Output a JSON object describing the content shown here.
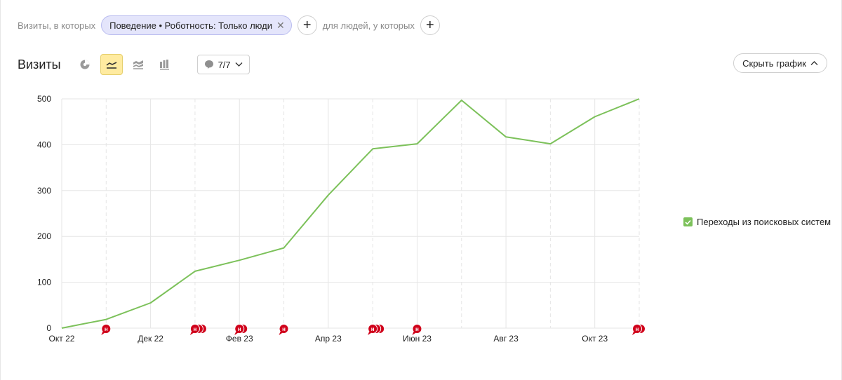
{
  "filter": {
    "prefix": "Визиты, в которых",
    "chip_label": "Поведение • Роботность: Только люди",
    "middle": "для людей, у которых"
  },
  "toolbar": {
    "title": "Визиты",
    "notes_label": "7/7",
    "hide_chart_label": "Скрыть график"
  },
  "icons": {
    "pie": "pie-chart-icon",
    "line": "line-chart-icon",
    "area": "area-chart-icon",
    "bar": "bar-chart-icon",
    "comment": "comment-icon",
    "chevron_down": "chevron-down-icon",
    "chevron_up": "chevron-up-icon",
    "plus": "plus-icon",
    "close": "close-icon",
    "checkbox": "checkbox-checked-icon"
  },
  "colors": {
    "series": "#7cc15a",
    "note_marker": "#d0021b",
    "active_button": "#ffeba0",
    "chip_bg": "#e4e5fb"
  },
  "chart_data": {
    "type": "line",
    "x": [
      "2022-10",
      "2022-11",
      "2022-12",
      "2023-01",
      "2023-02",
      "2023-03",
      "2023-04",
      "2023-05",
      "2023-06",
      "2023-07",
      "2023-08",
      "2023-09",
      "2023-10",
      "2023-11"
    ],
    "x_tick_labels": [
      "Окт 22",
      "Дек 22",
      "Фев 23",
      "Апр 23",
      "Июн 23",
      "Авг 23",
      "Окт 23"
    ],
    "x_tick_values": [
      "2022-10",
      "2022-12",
      "2023-02",
      "2023-04",
      "2023-06",
      "2023-08",
      "2023-10"
    ],
    "series": [
      {
        "name": "Переходы из поисковых систем",
        "color": "#7cc15a",
        "values": [
          0,
          19,
          55,
          124,
          148,
          175,
          290,
          391,
          402,
          497,
          417,
          402,
          461,
          500
        ]
      }
    ],
    "y_ticks": [
      0,
      100,
      200,
      300,
      400,
      500
    ],
    "ylim": [
      0,
      500
    ],
    "grid": true,
    "legend_position": "right",
    "notes": [
      {
        "x": "2022-11",
        "count": 1,
        "label": "н"
      },
      {
        "x": "2023-01",
        "count": 3,
        "label": "н"
      },
      {
        "x": "2023-02",
        "count": 2,
        "label": "н"
      },
      {
        "x": "2023-03",
        "count": 1,
        "label": "н"
      },
      {
        "x": "2023-05",
        "count": 3,
        "label": "н"
      },
      {
        "x": "2023-06",
        "count": 1,
        "label": "н"
      },
      {
        "x": "2023-11",
        "count": 2,
        "label": "н"
      }
    ]
  }
}
